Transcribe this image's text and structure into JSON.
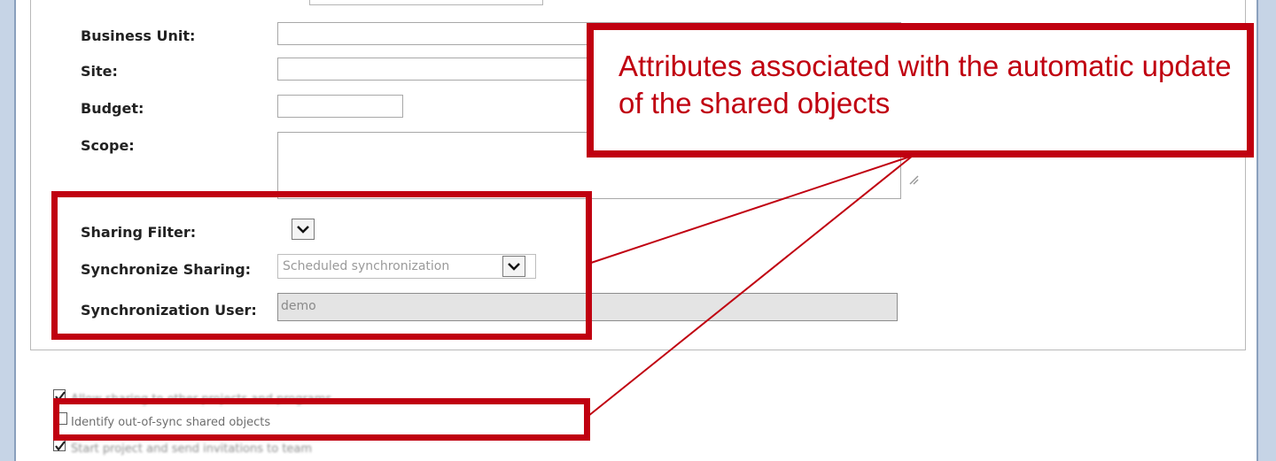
{
  "form": {
    "business_unit_label": "Business Unit:",
    "site_label": "Site:",
    "budget_label": "Budget:",
    "scope_label": "Scope:",
    "sharing_filter_label": "Sharing Filter:",
    "synchronize_sharing_label": "Synchronize Sharing:",
    "synchronize_sharing_value": "Scheduled synchronization",
    "synchronization_user_label": "Synchronization User:",
    "synchronization_user_value": "demo"
  },
  "options": {
    "allow_sharing": {
      "label": "Allow sharing to other projects and programs",
      "checked": true
    },
    "identify_out_of_sync": {
      "label": "Identify out-of-sync shared objects",
      "checked": false
    },
    "start_project": {
      "label": "Start project and send invitations to team",
      "checked": true
    }
  },
  "annotation": {
    "callout_text": "Attributes associated with the automatic update of the shared objects",
    "color": "#c00010"
  }
}
